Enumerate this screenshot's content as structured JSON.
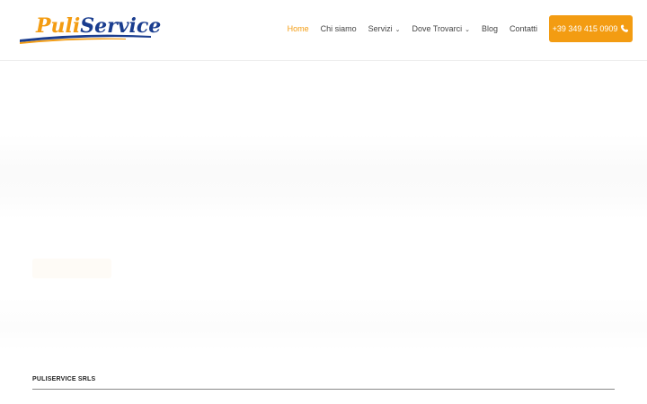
{
  "header": {
    "logo": {
      "part1": "Puli",
      "part2": "Service"
    },
    "nav": [
      {
        "label": "Home",
        "active": true,
        "has_dropdown": false
      },
      {
        "label": "Chi siamo",
        "active": false,
        "has_dropdown": false
      },
      {
        "label": "Servizi",
        "active": false,
        "has_dropdown": true
      },
      {
        "label": "Dove Trovarci",
        "active": false,
        "has_dropdown": true
      },
      {
        "label": "Blog",
        "active": false,
        "has_dropdown": false
      },
      {
        "label": "Contatti",
        "active": false,
        "has_dropdown": false
      }
    ],
    "phone_button": {
      "label": "+39 349 415 0909",
      "icon": "phone-icon"
    }
  },
  "footer": {
    "title": "PULISERVICE SRLS"
  },
  "colors": {
    "accent": "#f39c12",
    "brand_blue": "#1a3d8f",
    "text": "#444444"
  }
}
